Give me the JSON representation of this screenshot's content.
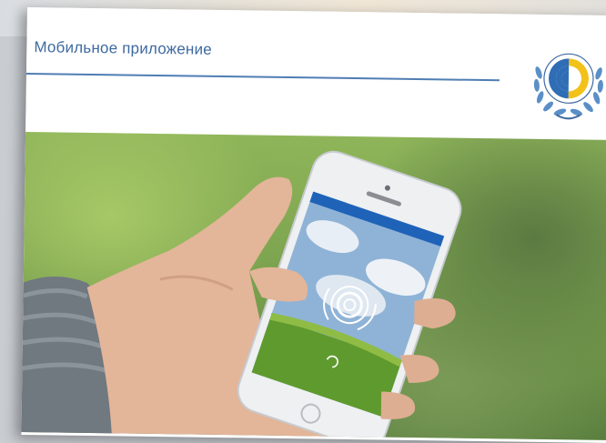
{
  "slide": {
    "title": "Мобильное приложение"
  },
  "icons": {
    "emblem": "fss-emblem-icon",
    "app_logo": "app-logo-icon",
    "loading": "loading-spinner-icon"
  },
  "colors": {
    "title": "#3f6aa0",
    "rule": "#4f7db3",
    "phone_status_bar": "#1f63b8"
  }
}
